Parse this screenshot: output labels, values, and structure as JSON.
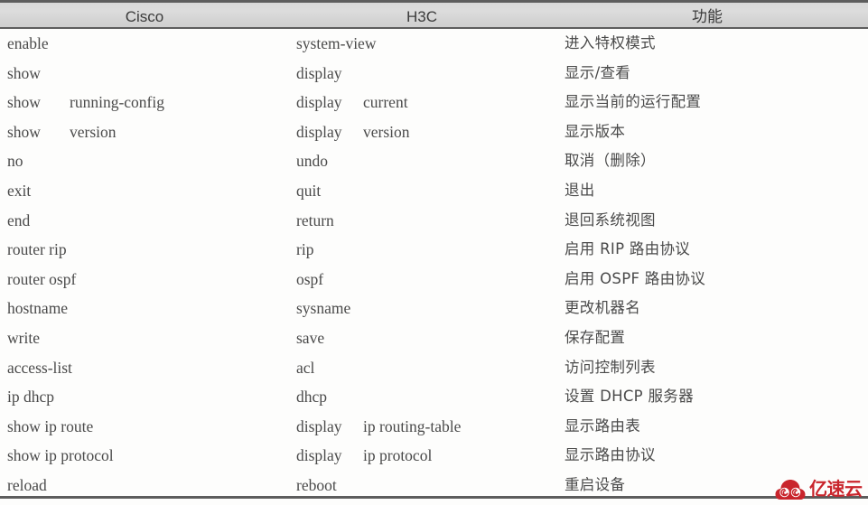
{
  "table": {
    "headers": [
      {
        "label": "Cisco"
      },
      {
        "label": "H3C"
      },
      {
        "label": "功能"
      }
    ],
    "rows": [
      {
        "cisco_a": "enable",
        "cisco_b": "",
        "h3c_a": "system-view",
        "h3c_b": "",
        "func": "进入特权模式"
      },
      {
        "cisco_a": "show",
        "cisco_b": "",
        "h3c_a": "display",
        "h3c_b": "",
        "func": "显示/查看"
      },
      {
        "cisco_a": "show",
        "cisco_b": "running-config",
        "h3c_a": "display",
        "h3c_b": "current",
        "func": "显示当前的运行配置"
      },
      {
        "cisco_a": "show",
        "cisco_b": "version",
        "h3c_a": "display",
        "h3c_b": "version",
        "func": "显示版本"
      },
      {
        "cisco_a": "no",
        "cisco_b": "",
        "h3c_a": "undo",
        "h3c_b": "",
        "func": "取消（删除）"
      },
      {
        "cisco_a": "exit",
        "cisco_b": "",
        "h3c_a": "quit",
        "h3c_b": "",
        "func": "退出"
      },
      {
        "cisco_a": "end",
        "cisco_b": "",
        "h3c_a": "return",
        "h3c_b": "",
        "func": "退回系统视图"
      },
      {
        "cisco_a": "router rip",
        "cisco_b": "",
        "h3c_a": "rip",
        "h3c_b": "",
        "func": "启用 RIP 路由协议"
      },
      {
        "cisco_a": "router ospf",
        "cisco_b": "",
        "h3c_a": "ospf",
        "h3c_b": "",
        "func": "启用 OSPF 路由协议"
      },
      {
        "cisco_a": "hostname",
        "cisco_b": "",
        "h3c_a": "sysname",
        "h3c_b": "",
        "func": "更改机器名"
      },
      {
        "cisco_a": "write",
        "cisco_b": "",
        "h3c_a": "save",
        "h3c_b": "",
        "func": "保存配置"
      },
      {
        "cisco_a": "access-list",
        "cisco_b": "",
        "h3c_a": "acl",
        "h3c_b": "",
        "func": "访问控制列表"
      },
      {
        "cisco_a": "ip dhcp",
        "cisco_b": "",
        "h3c_a": "dhcp",
        "h3c_b": "",
        "func": "设置 DHCP 服务器"
      },
      {
        "cisco_a": "show ip route",
        "cisco_b": "",
        "h3c_a": "display",
        "h3c_b": "ip routing-table",
        "func": "显示路由表"
      },
      {
        "cisco_a": "show ip protocol",
        "cisco_b": "",
        "h3c_a": "display",
        "h3c_b": "ip protocol",
        "func": "显示路由协议"
      },
      {
        "cisco_a": "reload",
        "cisco_b": "",
        "h3c_a": "reboot",
        "h3c_b": "",
        "func": "重启设备"
      }
    ]
  },
  "watermark": {
    "text": "亿速云",
    "icon": "cloud-swirl-icon",
    "color": "#c9252c"
  }
}
